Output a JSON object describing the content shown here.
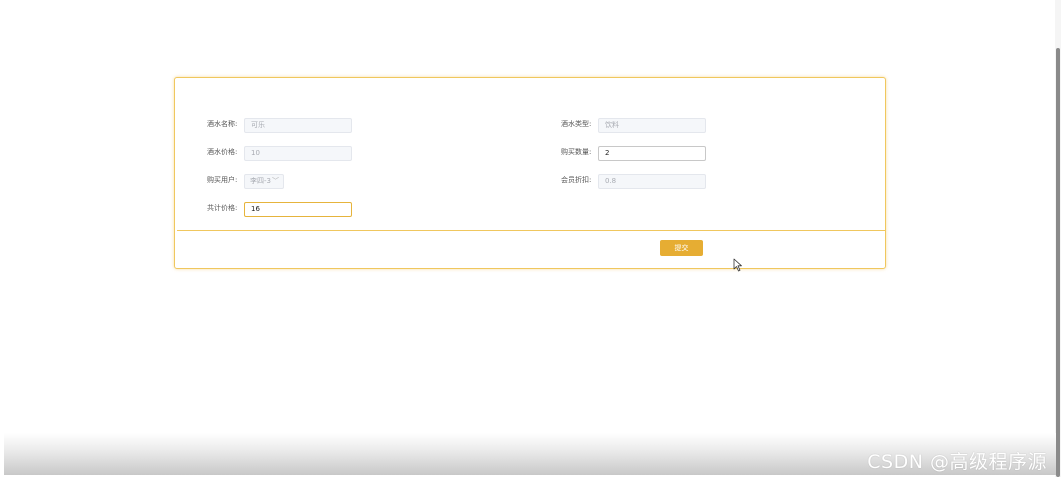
{
  "form": {
    "drink_name": {
      "label": "酒水名称:",
      "value": "可乐"
    },
    "drink_type": {
      "label": "酒水类型:",
      "value": "饮料"
    },
    "drink_price": {
      "label": "酒水价格:",
      "value": "10"
    },
    "quantity": {
      "label": "购买数量:",
      "value": "2"
    },
    "buyer": {
      "label": "购买用户:",
      "value": "李四-3"
    },
    "member_discount": {
      "label": "会员折扣:",
      "value": "0.8"
    },
    "total_price": {
      "label": "共计价格:",
      "value": "16"
    },
    "submit_label": "提交"
  },
  "watermark": "CSDN @高级程序源",
  "colors": {
    "accent": "#e6ad33",
    "card_border": "#f0c75e",
    "disabled_bg": "#f5f7fa"
  },
  "icons": {
    "select_chevron": "chevron-down-icon",
    "cursor": "mouse-pointer-icon"
  }
}
